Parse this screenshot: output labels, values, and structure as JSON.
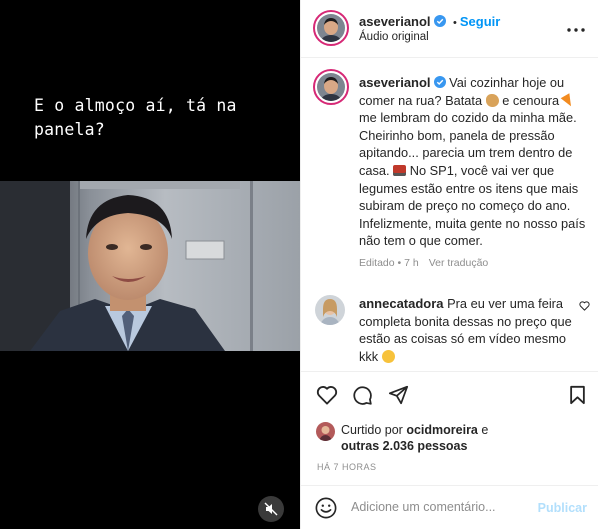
{
  "media": {
    "caption": "E o almoço aí, tá na panela?"
  },
  "header": {
    "username": "aseverianol",
    "separator": "•",
    "follow_label": "Seguir",
    "audio_label": "Áudio original",
    "more_icon": "more-horizontal-icon"
  },
  "post": {
    "username": "aseverianol",
    "text_1": "Vai cozinhar hoje ou comer na rua? Batata",
    "text_2": "e cenoura",
    "text_3": "me lembram do cozido da minha mãe. Cheirinho bom, panela de pressão apitando... parecia um trem dentro de casa.",
    "text_4": "No SP1, você vai ver que legumes estão entre os itens que mais subiram de preço no começo do ano. Infelizmente, muita gente no nosso país não tem o que comer.",
    "edited": "Editado • 7 h",
    "translation": "Ver tradução"
  },
  "comment": {
    "username": "annecatadora",
    "text": "Pra eu ver uma feira completa bonita dessas no preço que estão as coisas só em vídeo mesmo kkk"
  },
  "likes": {
    "liked_by_label": "Curtido por",
    "liked_by_user": "ocidmoreira",
    "and_label": "e",
    "others_line": "outras 2.036 pessoas"
  },
  "time": "HÁ 7 HORAS",
  "add_comment": {
    "placeholder": "Adicione um comentário...",
    "post_label": "Publicar"
  },
  "colors": {
    "accent": "#0095f6",
    "ring": "#d62976",
    "muted": "#8e8e8e"
  }
}
